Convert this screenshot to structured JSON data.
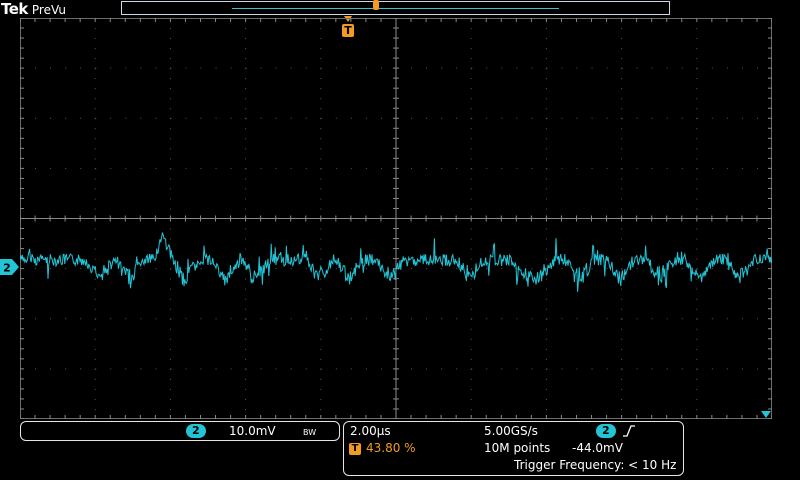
{
  "brand": {
    "logo": "Tek",
    "mode": "PreVu"
  },
  "channel": {
    "number": "2",
    "vertical_scale": "10.0mV",
    "bandwidth_limit": "BW",
    "color": "#23c4d6"
  },
  "timebase": {
    "horizontal_scale": "2.00µs",
    "sample_rate": "5.00GS/s",
    "record_length": "10M points",
    "trigger_position": "43.80 %"
  },
  "trigger": {
    "source": "2",
    "slope_icon": "rising-edge-icon",
    "level": "-44.0mV",
    "frequency": "Trigger Frequency: < 10 Hz",
    "marker": "T",
    "color": "#f29a22"
  }
}
